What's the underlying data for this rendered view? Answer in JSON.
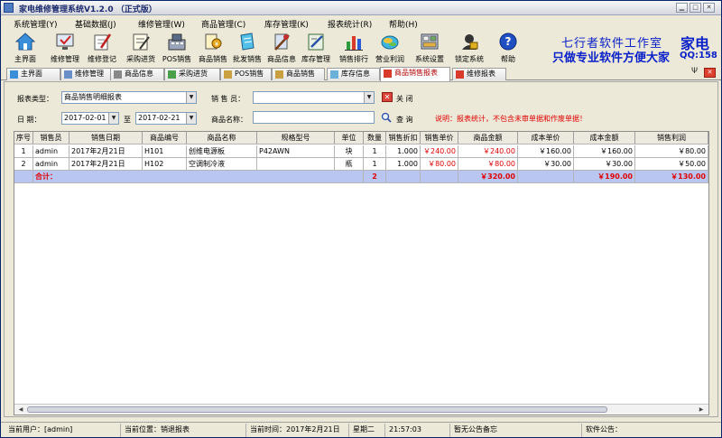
{
  "window": {
    "title": "家电维修管理系统V1.2.0 （正式版）"
  },
  "menu": [
    "系统管理(Y)",
    "基础数据(J)",
    "维修管理(W)",
    "商品管理(C)",
    "库存管理(K)",
    "报表统计(R)",
    "帮助(H)"
  ],
  "toolbar": [
    "主界面",
    "维修管理",
    "维修登记",
    "采购进货",
    "POS销售",
    "商品销售",
    "批发销售",
    "商品信息",
    "库存管理",
    "销售排行",
    "营业利润",
    "系统设置",
    "锁定系统",
    "帮助"
  ],
  "brand": {
    "line1": "七行者软件工作室",
    "line2": "只做专业软件方便大家",
    "right": "家电",
    "qq": "QQ:158"
  },
  "tabs": [
    "主界面",
    "维修管理",
    "商品信息",
    "采购进货",
    "POS销售",
    "商品销售",
    "库存信息",
    "商品销售报表",
    "维修报表"
  ],
  "tab_controls": {
    "pin": "Ψ",
    "close": "✕"
  },
  "filters": {
    "report_type_label": "报表类型：",
    "report_type_value": "商品销售明细报表",
    "salesperson_label": "销 售 员：",
    "salesperson_value": "",
    "close_label": "关 闭",
    "date_label": "日   期：",
    "date_from": "2017-02-01",
    "date_to": "2017-02-21",
    "to_label": "至",
    "product_name_label": "商品名称：",
    "product_name_value": "",
    "query_label": "查 询",
    "note": "说明：报表统计，不包含未审单据和作废单据！"
  },
  "table": {
    "columns": [
      "序号",
      "销售员",
      "销售日期",
      "商品编号",
      "商品名称",
      "规格型号",
      "单位",
      "数量",
      "销售折扣",
      "销售单价",
      "商品金额",
      "成本单价",
      "成本金额",
      "销售利润"
    ],
    "rows": [
      [
        "1",
        "admin",
        "2017年2月21日",
        "H101",
        "创维电源板",
        "P42AWN",
        "块",
        "1",
        "1.000",
        "￥240.00",
        "￥240.00",
        "￥160.00",
        "￥160.00",
        "￥80.00"
      ],
      [
        "2",
        "admin",
        "2017年2月21日",
        "H102",
        "空调制冷液",
        "",
        "瓶",
        "1",
        "1.000",
        "￥80.00",
        "￥80.00",
        "￥30.00",
        "￥30.00",
        "￥50.00"
      ]
    ],
    "totals": {
      "label": "合计：",
      "quantity": "2",
      "amount": "￥320.00",
      "cost": "￥190.00",
      "profit": "￥130.00"
    }
  },
  "status": {
    "user": "当前用户：[admin]",
    "location": "当前位置：销退报表",
    "time": "当前时间：2017年2月21日",
    "weekday": "星期二",
    "clock": "21:57:03",
    "memo": "暂无公告备忘",
    "notice": "软件公告："
  },
  "colors": {
    "accent_blue": "#0a20c8",
    "alert_red": "#e00000",
    "total_row": "#b9c6f1"
  }
}
